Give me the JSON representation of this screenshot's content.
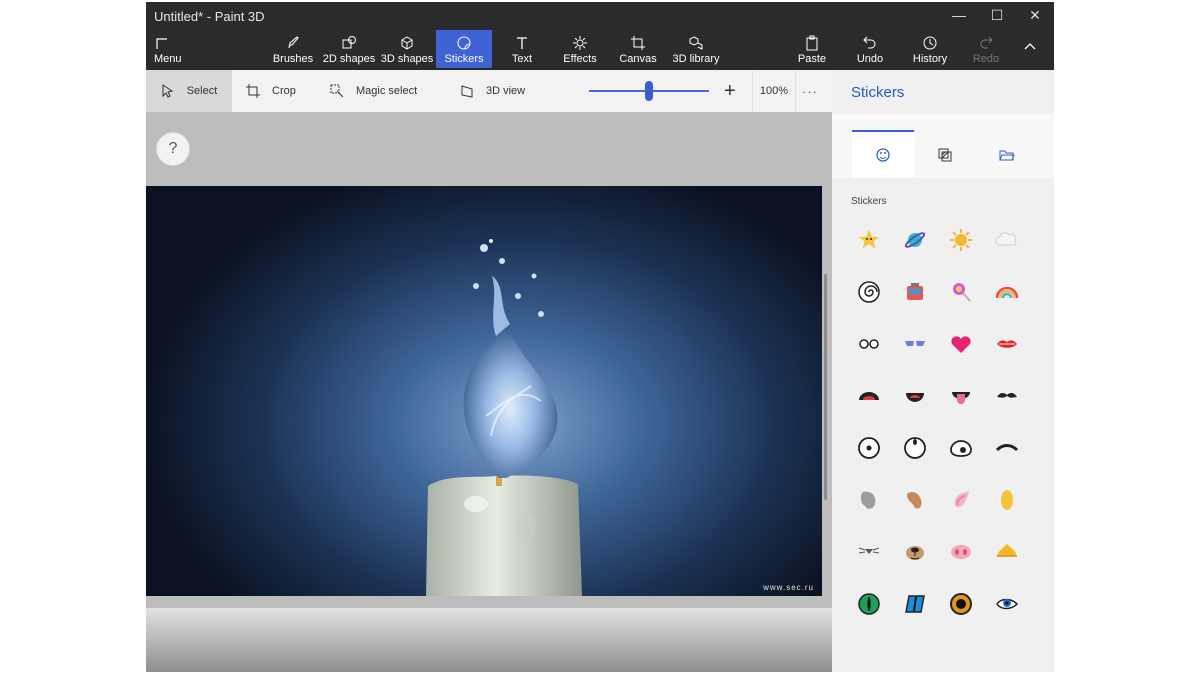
{
  "window": {
    "title": "Untitled* - Paint 3D",
    "minimize": "—",
    "maximize": "☐",
    "close": "✕"
  },
  "ribbon": {
    "menu": "Menu",
    "tools": [
      {
        "label": "Brushes",
        "icon": "brush-icon"
      },
      {
        "label": "2D shapes",
        "icon": "2d-shapes-icon"
      },
      {
        "label": "3D shapes",
        "icon": "3d-shapes-icon"
      },
      {
        "label": "Stickers",
        "icon": "stickers-icon",
        "active": true
      },
      {
        "label": "Text",
        "icon": "text-icon"
      },
      {
        "label": "Effects",
        "icon": "effects-icon"
      },
      {
        "label": "Canvas",
        "icon": "canvas-icon"
      },
      {
        "label": "3D library",
        "icon": "3d-library-icon"
      }
    ],
    "actions": [
      {
        "label": "Paste",
        "icon": "paste-icon"
      },
      {
        "label": "Undo",
        "icon": "undo-icon"
      },
      {
        "label": "History",
        "icon": "history-icon"
      },
      {
        "label": "Redo",
        "icon": "redo-icon",
        "disabled": true
      }
    ],
    "collapse_icon": "chevron-up-icon",
    "active_color": "#3f63d6"
  },
  "toolbar": {
    "select": "Select",
    "crop": "Crop",
    "magic_select": "Magic select",
    "view_3d": "3D view",
    "zoom_value": "100%",
    "zoom_plus": "+",
    "more": "···"
  },
  "workspace": {
    "help": "?",
    "watermark": "www.sec.ru"
  },
  "panel": {
    "title": "Stickers",
    "section_label": "Stickers",
    "title_color": "#1e5ec8",
    "tabs": [
      "stickers-tab-icon",
      "textures-tab-icon",
      "open-folder-icon"
    ],
    "stickers": [
      "star-sticker",
      "planet-sticker",
      "sun-sticker",
      "cloud-sticker",
      "spiral-sticker",
      "robot-sticker",
      "lollipop-sticker",
      "rainbow-sticker",
      "glasses-sticker",
      "sunglasses-sticker",
      "heart-sticker",
      "lips-sticker",
      "open-mouth-sticker",
      "smile-mouth-sticker",
      "tongue-mouth-sticker",
      "mustache-sticker",
      "eye-center-sticker",
      "eye-up-sticker",
      "eye-side-sticker",
      "eyebrow-sticker",
      "grey-ear-sticker",
      "brown-ear-sticker",
      "pink-ear-sticker",
      "yellow-ear-sticker",
      "whisker-nose-sticker",
      "dog-nose-sticker",
      "pig-nose-sticker",
      "beak-sticker",
      "green-cat-eye-sticker",
      "blue-cat-eye-sticker",
      "orange-eye-sticker",
      "blue-eye-sticker"
    ]
  }
}
